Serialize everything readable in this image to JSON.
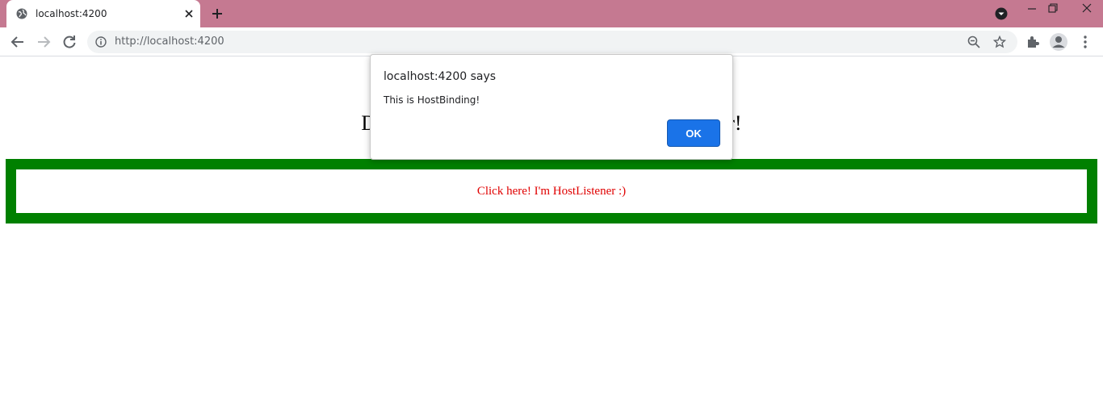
{
  "browser": {
    "tab_title": "localhost:4200",
    "url": "http://localhost:4200",
    "titlebar_color": "#c57991",
    "icons": [
      "globe-icon",
      "close-icon",
      "plus-icon",
      "chevron-down-icon",
      "minimize-icon",
      "maximize-icon",
      "window-close-icon",
      "back-arrow-icon",
      "forward-arrow-icon",
      "reload-icon",
      "info-icon",
      "zoom-out-icon",
      "star-icon",
      "puzzle-icon",
      "profile-icon",
      "kebab-menu-icon"
    ]
  },
  "page": {
    "heading_left": "De",
    "heading_right": "er!",
    "box_text": "Click here! I'm HostListener :)",
    "box_border_color": "#008000",
    "box_text_color": "#e00000"
  },
  "dialog": {
    "title": "localhost:4200 says",
    "message": "This is HostBinding!",
    "ok_label": "OK",
    "accent": "#1a73e8"
  }
}
